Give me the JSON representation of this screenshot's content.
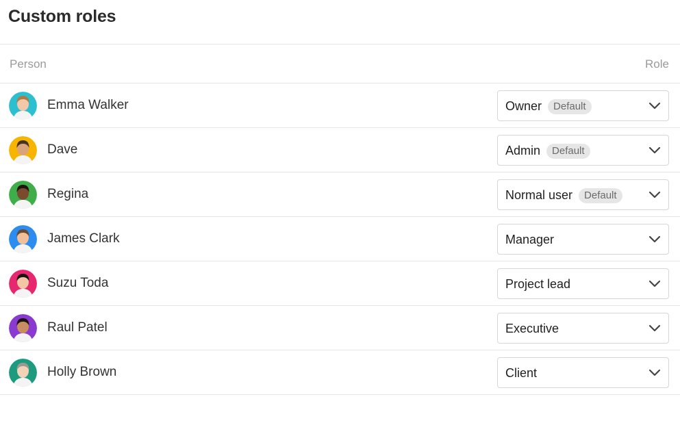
{
  "page": {
    "title": "Custom roles"
  },
  "table": {
    "headers": {
      "person": "Person",
      "role": "Role"
    },
    "rows": [
      {
        "name": "Emma Walker",
        "role": "Owner",
        "badge": "Default",
        "avatar_icon": "person-avatar",
        "avatar_color": "#2bbfd0"
      },
      {
        "name": "Dave",
        "role": "Admin",
        "badge": "Default",
        "avatar_icon": "person-avatar",
        "avatar_color": "#f7b500"
      },
      {
        "name": "Regina",
        "role": "Normal user",
        "badge": "Default",
        "avatar_icon": "person-avatar",
        "avatar_color": "#3fae4a"
      },
      {
        "name": "James Clark",
        "role": "Manager",
        "badge": "",
        "avatar_icon": "person-avatar",
        "avatar_color": "#2d8cf0"
      },
      {
        "name": "Suzu Toda",
        "role": "Project lead",
        "badge": "",
        "avatar_icon": "person-avatar",
        "avatar_color": "#e8286e"
      },
      {
        "name": "Raul Patel",
        "role": "Executive",
        "badge": "",
        "avatar_icon": "person-avatar",
        "avatar_color": "#8b3ad1"
      },
      {
        "name": "Holly Brown",
        "role": "Client",
        "badge": "",
        "avatar_icon": "person-avatar",
        "avatar_color": "#1c9b7e"
      }
    ]
  },
  "icons": {
    "dropdown": "chevron-down-icon"
  }
}
